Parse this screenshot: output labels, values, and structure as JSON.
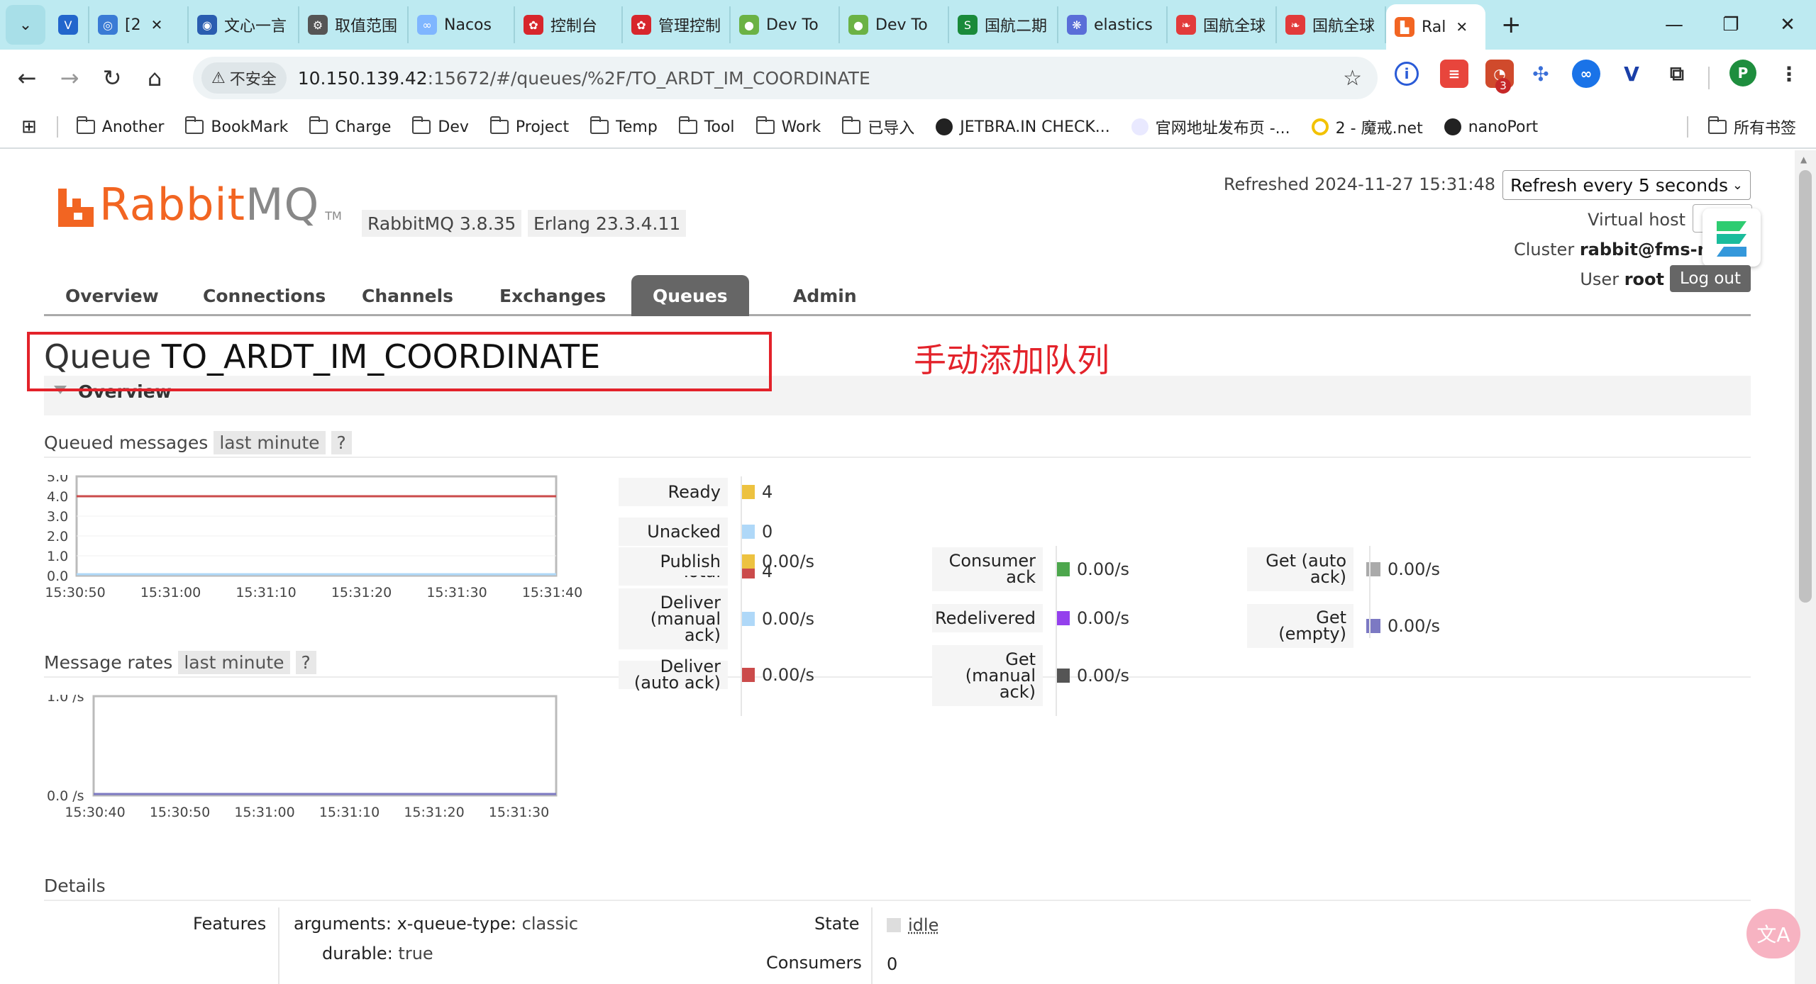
{
  "browser": {
    "tabs": [
      {
        "label": "",
        "icon_color": "#2266cc",
        "icon": "V"
      },
      {
        "label": "[2",
        "icon_color": "#3a7bd5",
        "icon": "◎",
        "closable": true
      },
      {
        "label": "文心一言",
        "icon_color": "#2a5db0",
        "icon": "◉"
      },
      {
        "label": "取值范围",
        "icon_color": "#555555",
        "icon": "⚙"
      },
      {
        "label": "Nacos",
        "icon_color": "#7fb6ff",
        "icon": "∞"
      },
      {
        "label": "控制台",
        "icon_color": "#d7262c",
        "icon": "✿"
      },
      {
        "label": "管理控制",
        "icon_color": "#d7262c",
        "icon": "✿"
      },
      {
        "label": "Dev To",
        "icon_color": "#6bb245",
        "icon": "●"
      },
      {
        "label": "Dev To",
        "icon_color": "#6bb245",
        "icon": "●"
      },
      {
        "label": "国航二期",
        "icon_color": "#1a8a3a",
        "icon": "S"
      },
      {
        "label": "elastics",
        "icon_color": "#5a6ed8",
        "icon": "❋"
      },
      {
        "label": "国航全球",
        "icon_color": "#e23b3b",
        "icon": "❧"
      },
      {
        "label": "国航全球",
        "icon_color": "#e23b3b",
        "icon": "❧"
      },
      {
        "label": "Ral",
        "icon_color": "#f26522",
        "icon": "▙",
        "active": true,
        "closable": true
      }
    ],
    "new_tab": "+",
    "window_controls": [
      "—",
      "❐",
      "✕"
    ],
    "address": {
      "security_label": "不安全",
      "host": "10.150.139.42",
      "path": ":15672/#/queues/%2F/TO_ARDT_IM_COORDINATE"
    },
    "bookmarks": [
      {
        "label": "Another",
        "type": "folder"
      },
      {
        "label": "BookMark",
        "type": "folder"
      },
      {
        "label": "Charge",
        "type": "folder"
      },
      {
        "label": "Dev",
        "type": "folder"
      },
      {
        "label": "Project",
        "type": "folder"
      },
      {
        "label": "Temp",
        "type": "folder"
      },
      {
        "label": "Tool",
        "type": "folder"
      },
      {
        "label": "Work",
        "type": "folder"
      },
      {
        "label": "已导入",
        "type": "folder"
      },
      {
        "label": "JETBRA.IN CHECK...",
        "type": "site"
      },
      {
        "label": "官网地址发布页 -...",
        "type": "site"
      },
      {
        "label": "2 - 魔戒.net",
        "type": "site"
      },
      {
        "label": "nanoPort",
        "type": "site"
      }
    ],
    "all_bookmarks": "所有书签",
    "profile_initial": "P",
    "ext_badge": "3"
  },
  "rabbit": {
    "logo_main": "Rabbit",
    "logo_mq": "MQ",
    "logo_tm": "TM",
    "version": "RabbitMQ 3.8.35",
    "erlang": "Erlang 23.3.4.11",
    "refreshed": "Refreshed 2024-11-27 15:31:48",
    "refresh_option": "Refresh every 5 seconds",
    "vhost_label": "Virtual host",
    "cluster_label": "Cluster",
    "cluster_value": "rabbit@fms-n",
    "user_label": "User",
    "user_value": "root",
    "logout": "Log out",
    "nav": [
      "Overview",
      "Connections",
      "Channels",
      "Exchanges",
      "Queues",
      "Admin"
    ],
    "active_nav": "Queues"
  },
  "queue": {
    "title_prefix": "Queue",
    "name": "TO_ARDT_IM_COORDINATE",
    "annotation": "手动添加队列",
    "section": "Overview"
  },
  "queued": {
    "label": "Queued messages",
    "range": "last minute",
    "help": "?",
    "stats": [
      {
        "label": "Ready",
        "value": "4",
        "color": "#edc240"
      },
      {
        "label": "Unacked",
        "value": "0",
        "color": "#afd8f8"
      },
      {
        "label": "Total",
        "value": "4",
        "color": "#cb4b4b"
      }
    ]
  },
  "rates": {
    "label": "Message rates",
    "range": "last minute",
    "help": "?",
    "col1": [
      {
        "label": "Publish",
        "value": "0.00/s",
        "color": "#edc240"
      },
      {
        "label": "Deliver (manual ack)",
        "value": "0.00/s",
        "color": "#afd8f8"
      },
      {
        "label": "Deliver (auto ack)",
        "value": "0.00/s",
        "color": "#cb4b4b"
      }
    ],
    "col2": [
      {
        "label": "Consumer ack",
        "value": "0.00/s",
        "color": "#4da74d"
      },
      {
        "label": "Redelivered",
        "value": "0.00/s",
        "color": "#9440ed"
      },
      {
        "label": "Get (manual ack)",
        "value": "0.00/s",
        "color": "#555555"
      }
    ],
    "col3": [
      {
        "label": "Get (auto ack)",
        "value": "0.00/s",
        "color": "#aaaaaa"
      },
      {
        "label": "Get (empty)",
        "value": "0.00/s",
        "color": "#7c79c3"
      }
    ]
  },
  "details": {
    "label": "Details",
    "features_label": "Features",
    "arguments_key": "arguments:",
    "arguments_sub_key": "x-queue-type:",
    "arguments_sub_value": "classic",
    "durable_key": "durable:",
    "durable_value": "true",
    "state_label": "State",
    "state_value": "idle",
    "consumers_label": "Consumers",
    "consumers_value": "0"
  },
  "chart_data": [
    {
      "type": "line",
      "title": "Queued messages",
      "x": [
        "15:30:50",
        "15:31:00",
        "15:31:10",
        "15:31:20",
        "15:31:30",
        "15:31:40"
      ],
      "y_ticks": [
        "0.0",
        "1.0",
        "2.0",
        "3.0",
        "4.0",
        "5.0"
      ],
      "ylim": [
        0,
        5
      ],
      "series": [
        {
          "name": "Ready",
          "color": "#edc240",
          "values": [
            4,
            4,
            4,
            4,
            4,
            4
          ]
        },
        {
          "name": "Unacked",
          "color": "#afd8f8",
          "values": [
            0,
            0,
            0,
            0,
            0,
            0
          ]
        },
        {
          "name": "Total",
          "color": "#cb4b4b",
          "values": [
            4,
            4,
            4,
            4,
            4,
            4
          ]
        }
      ]
    },
    {
      "type": "line",
      "title": "Message rates",
      "x": [
        "15:30:40",
        "15:30:50",
        "15:31:00",
        "15:31:10",
        "15:31:20",
        "15:31:30"
      ],
      "y_ticks": [
        "0.0 /s",
        "1.0 /s"
      ],
      "ylim": [
        0,
        1
      ],
      "series": [
        {
          "name": "Get (empty)",
          "color": "#7c79c3",
          "values": [
            0,
            0,
            0,
            0,
            0,
            0
          ]
        }
      ]
    }
  ]
}
